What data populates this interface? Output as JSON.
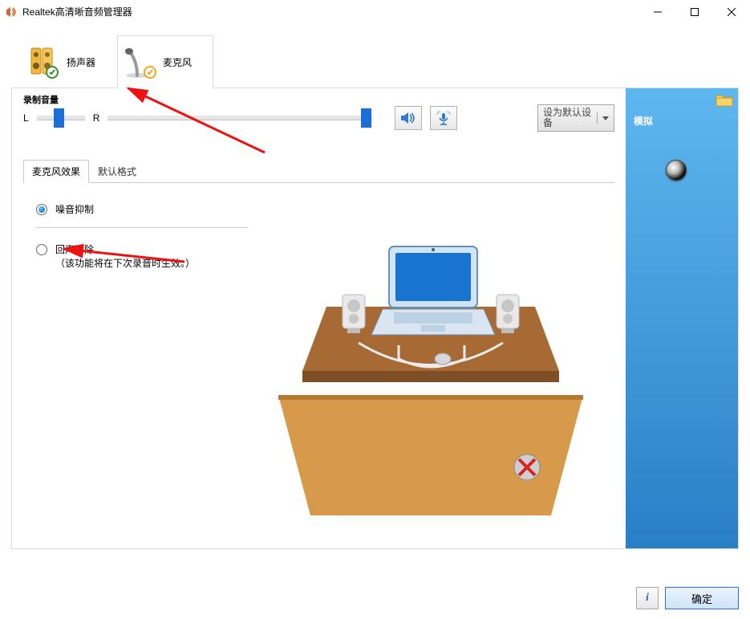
{
  "window": {
    "title": "Realtek高清晰音频管理器"
  },
  "device_tabs": {
    "speaker": "扬声器",
    "microphone": "麦克风"
  },
  "recording": {
    "section_label": "录制音量",
    "left_label": "L",
    "right_label": "R",
    "left_value": 0.35,
    "right_value": 0.96
  },
  "set_default": {
    "label": "设为默认设备"
  },
  "sub_tabs": {
    "effects": "麦克风效果",
    "default_format": "默认格式"
  },
  "effects": {
    "noise_suppression": "噪音抑制",
    "echo_cancellation": "回声消除",
    "echo_note": "（该功能将在下次录音时生效。）"
  },
  "right_panel": {
    "title": "模拟"
  },
  "buttons": {
    "ok": "确定"
  }
}
